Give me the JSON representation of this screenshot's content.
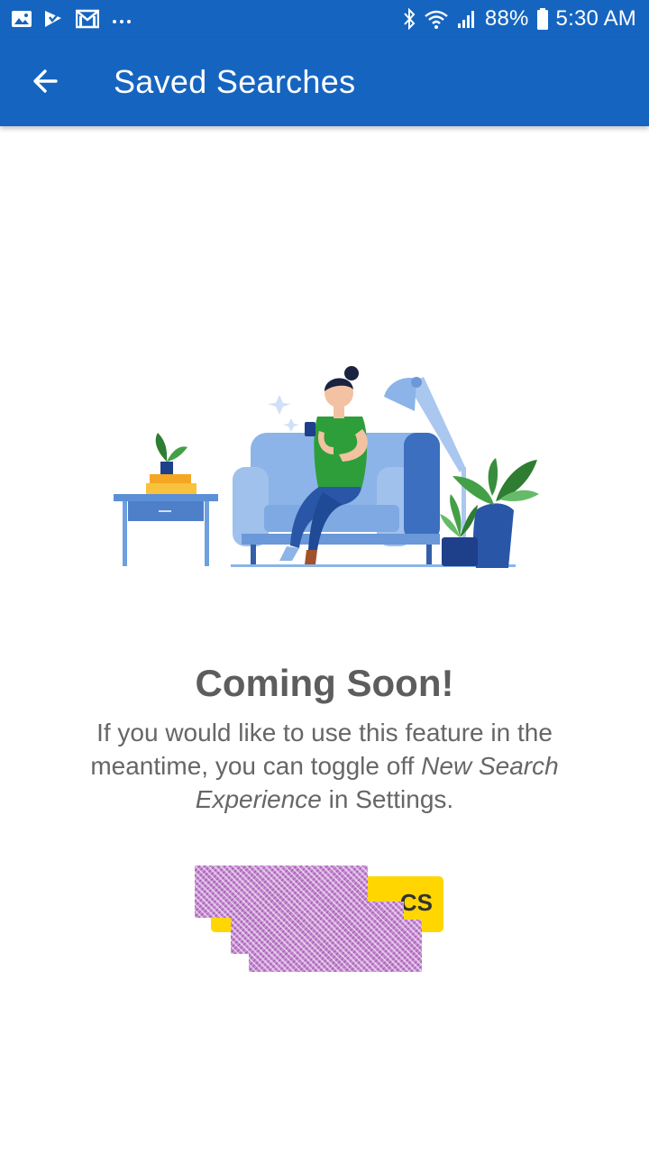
{
  "status_bar": {
    "battery_percent": "88%",
    "time": "5:30 AM",
    "left_icons": [
      "gallery-icon",
      "flag-icon",
      "gmail-icon",
      "more-dots-icon"
    ],
    "right_icons": [
      "bluetooth-icon",
      "wifi-icon",
      "signal-icon",
      "battery-icon"
    ]
  },
  "app_bar": {
    "title": "Saved Searches",
    "back_icon": "arrow-back-icon"
  },
  "empty_state": {
    "heading": "Coming Soon!",
    "message_part1": "If you would like to use this feature in the meantime, you can toggle off ",
    "message_emphasis": "New Search Experience",
    "message_part2": " in Settings."
  },
  "action_button": {
    "visible_label_fragment": "CS"
  },
  "colors": {
    "primary": "#1565c0",
    "heading_text": "#5d5d5d",
    "body_text": "#666666",
    "accent_yellow": "#ffd600"
  }
}
